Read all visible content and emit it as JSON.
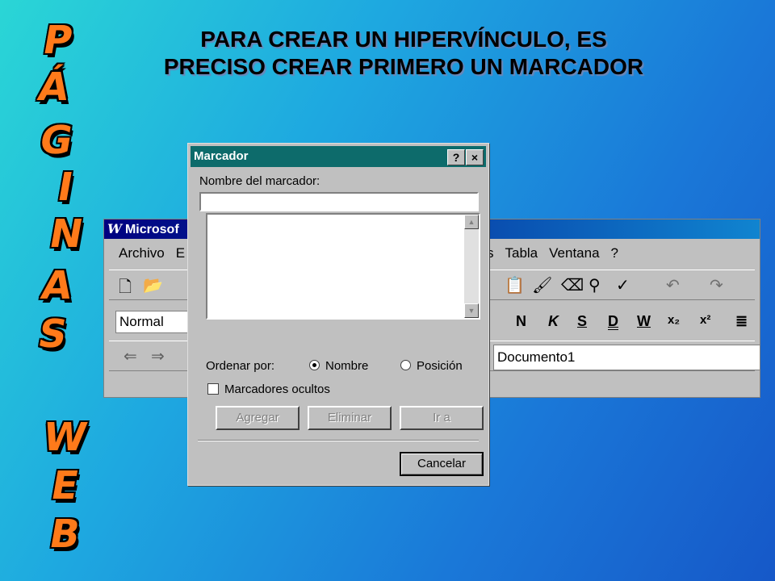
{
  "slide": {
    "title": "PARA CREAR UN HIPERVÍNCULO, ES PRECISO CREAR PRIMERO UN MARCADOR",
    "vertical_letters": [
      "P",
      "Á",
      "G",
      "I",
      "N",
      "A",
      "S",
      "W",
      "E",
      "B"
    ]
  },
  "word_window": {
    "title": "Microsof",
    "menu": {
      "archivo": "Archivo",
      "e": "E",
      "s": "s",
      "tabla": "Tabla",
      "ventana": "Ventana",
      "help": "?"
    },
    "style_value": "Normal",
    "document_value": "Documento1",
    "format_buttons": [
      "N",
      "K",
      "S",
      "D",
      "W"
    ]
  },
  "dialog": {
    "title": "Marcador",
    "help_button": "?",
    "close_button": "×",
    "name_label": "Nombre del marcador:",
    "name_value": "",
    "sort_label": "Ordenar por:",
    "sort_options": {
      "nombre": "Nombre",
      "posicion": "Posición"
    },
    "sort_selected": "Nombre",
    "hidden_label": "Marcadores ocultos",
    "hidden_checked": false,
    "buttons": {
      "agregar": "Agregar",
      "eliminar": "Eliminar",
      "ir_a": "Ir a",
      "cancelar": "Cancelar"
    }
  },
  "colors": {
    "dialog_titlebar": "#0d6b6b",
    "word_art": "#ff7a1a"
  }
}
